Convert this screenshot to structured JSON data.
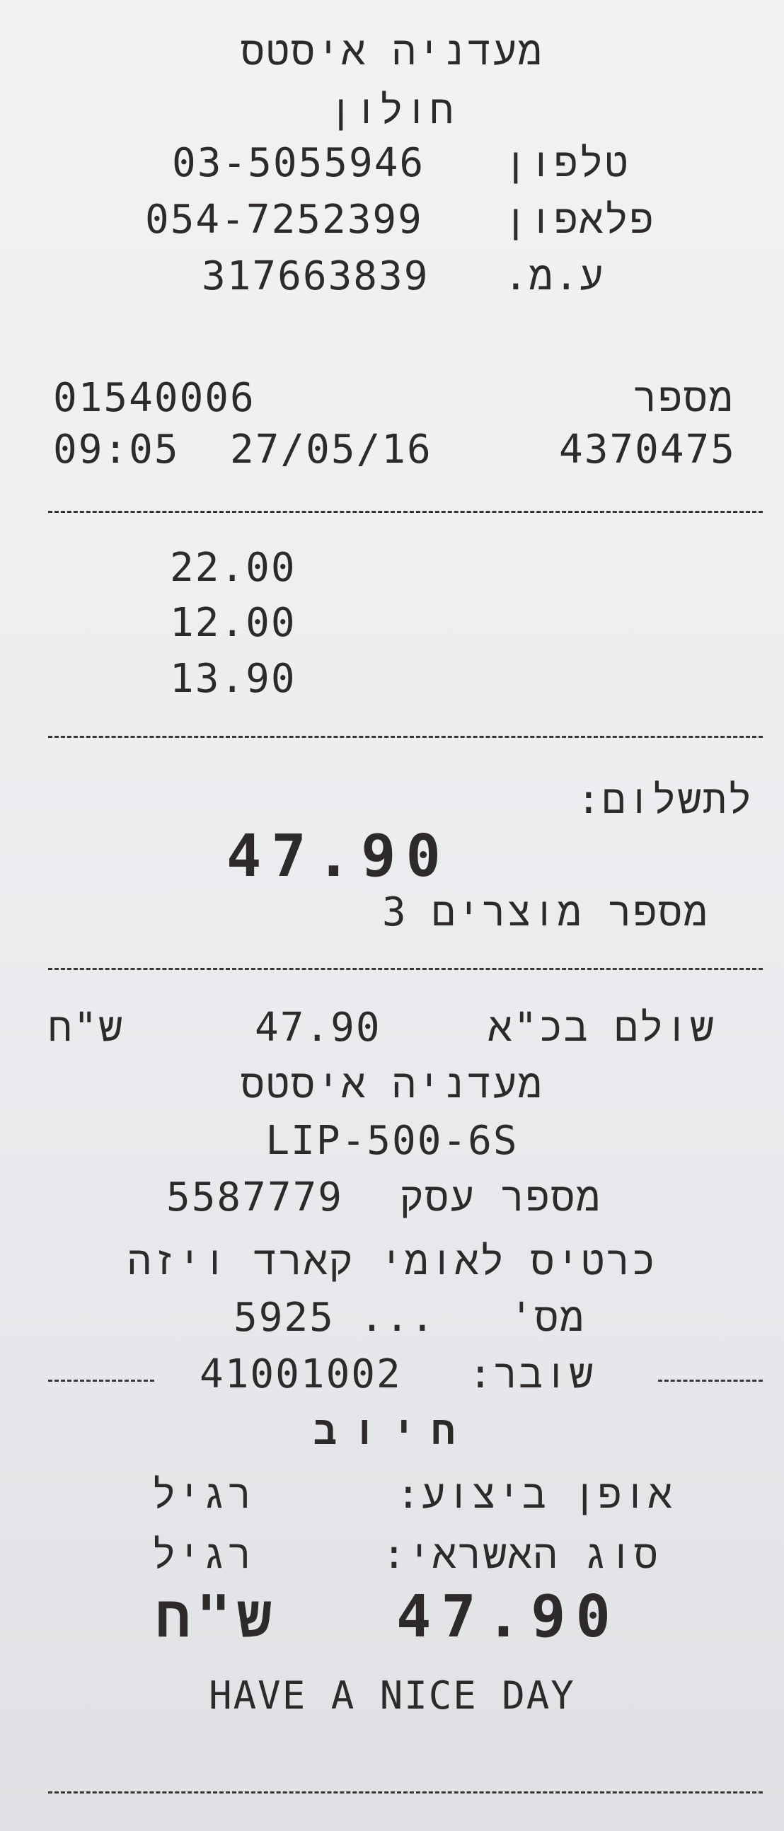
{
  "header": {
    "store_name": "מעדניה איסטס",
    "city": "חולון",
    "phone_label": "טלפון",
    "phone": "03-5055946",
    "mobile_label": "פלאפון",
    "mobile": "054-7252399",
    "company_id_label": "ע.מ.",
    "company_id": "317663839"
  },
  "meta": {
    "terminal": "01540006",
    "number_label": "מספר",
    "time": "09:05",
    "date": "27/05/16",
    "receipt_number": "4370475"
  },
  "items": [
    {
      "price": "22.00"
    },
    {
      "price": "12.00"
    },
    {
      "price": "13.90"
    }
  ],
  "totals": {
    "to_pay_label": "לתשלום:",
    "to_pay": "47.90",
    "item_count_label": "מספר מוצרים",
    "item_count": "3"
  },
  "payment": {
    "paid_label": "שולם בכ\"א",
    "paid_amount": "47.90",
    "currency": "ש\"ח",
    "merchant_name": "מעדניה איסטס",
    "terminal_code": "LIP-500-6S",
    "business_number_label": "מספר עסק",
    "business_number": "5587779",
    "card_type": "כרטיס לאומי קארד ויזה",
    "card_number_label": "מס'",
    "card_last4": "5925 ...",
    "voucher_label": "שובר:",
    "voucher_number": "41001002",
    "charge_label": "חיוב",
    "execution_label": "אופן ביצוע:",
    "execution_value": "רגיל",
    "credit_type_label": "סוג האשראי:",
    "credit_type_value": "רגיל",
    "final_amount": "47.90",
    "final_currency": "ש\"ח"
  },
  "footer": {
    "message": "HAVE A NICE DAY"
  }
}
